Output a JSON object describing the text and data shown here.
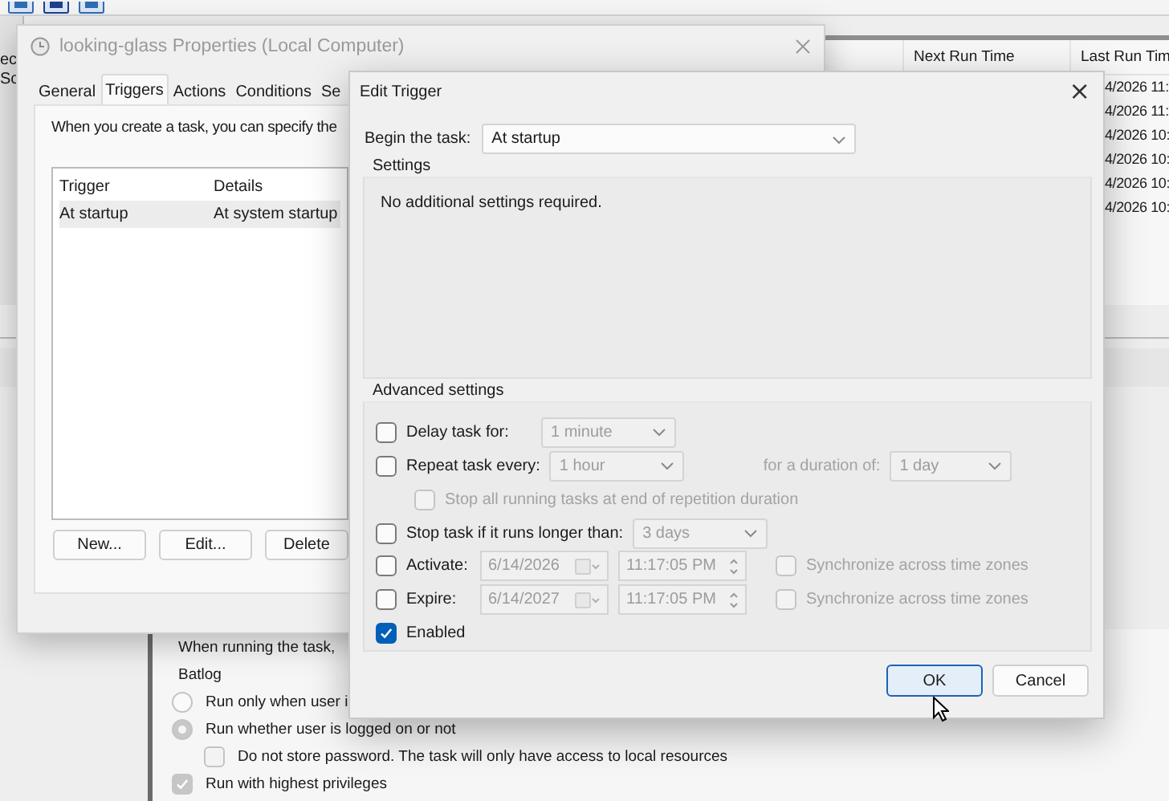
{
  "scheduler": {
    "left_pane": [
      "ec",
      "Sc"
    ],
    "columns": [
      "Next Run Time",
      "Last Run Tim"
    ],
    "rows": [
      "4/2026 11:",
      "4/2026 11:",
      "4/2026 10:",
      "4/2026 10:",
      "4/2026 10:",
      "4/2026 10:"
    ],
    "security": {
      "intro": "When running the task,",
      "account": "Batlog",
      "options": [
        {
          "label": "Run only when user i",
          "selected": false
        },
        {
          "label": "Run whether user is logged on or not",
          "selected": true
        }
      ],
      "checks": [
        {
          "label": "Do not store password.  The task will only have access to local resources",
          "checked": false,
          "indented": true
        },
        {
          "label": "Run with highest privileges",
          "checked": true,
          "indented": false
        }
      ]
    }
  },
  "properties": {
    "title": "looking-glass Properties (Local Computer)",
    "tabs": [
      {
        "label": "General",
        "selected": false
      },
      {
        "label": "Triggers",
        "selected": true
      },
      {
        "label": "Actions",
        "selected": false
      },
      {
        "label": "Conditions",
        "selected": false
      },
      {
        "label": "Se",
        "selected": false
      }
    ],
    "intro": "When you create a task, you can specify the",
    "columns": [
      "Trigger",
      "Details"
    ],
    "rows": [
      {
        "trigger": "At startup",
        "details": "At system startup",
        "selected": true
      }
    ],
    "buttons": [
      "New...",
      "Edit...",
      "Delete"
    ]
  },
  "edit_trigger": {
    "title": "Edit Trigger",
    "close": "×",
    "begin_label": "Begin the task:",
    "begin_value": "At startup",
    "settings_title": "Settings",
    "settings_text": "No additional settings required.",
    "advanced_title": "Advanced settings",
    "rows": [
      {
        "kind": "dropdown",
        "label": "Delay task for:",
        "checked": false,
        "value": "1 minute"
      },
      {
        "kind": "repeat",
        "label": "Repeat task every:",
        "checked": false,
        "value": "1 hour",
        "duration_label": "for a duration of:",
        "duration": "1 day"
      },
      {
        "kind": "sub",
        "label": "Stop all running tasks at end of repetition duration",
        "checked": false
      },
      {
        "kind": "dropdown",
        "label": "Stop task if it runs longer than:",
        "checked": false,
        "value": "3 days"
      },
      {
        "kind": "datetime",
        "label": "Activate:",
        "checked": false,
        "date": "6/14/2026",
        "time": "11:17:05 PM",
        "sync_label": "Synchronize across time zones",
        "sync_checked": false
      },
      {
        "kind": "datetime",
        "label": "Expire:",
        "checked": false,
        "date": "6/14/2027",
        "time": "11:17:05 PM",
        "sync_label": "Synchronize across time zones",
        "sync_checked": false
      },
      {
        "kind": "check",
        "label": "Enabled",
        "checked": true
      }
    ],
    "buttons": [
      {
        "label": "OK",
        "default": true
      },
      {
        "label": "Cancel",
        "default": false
      }
    ]
  }
}
